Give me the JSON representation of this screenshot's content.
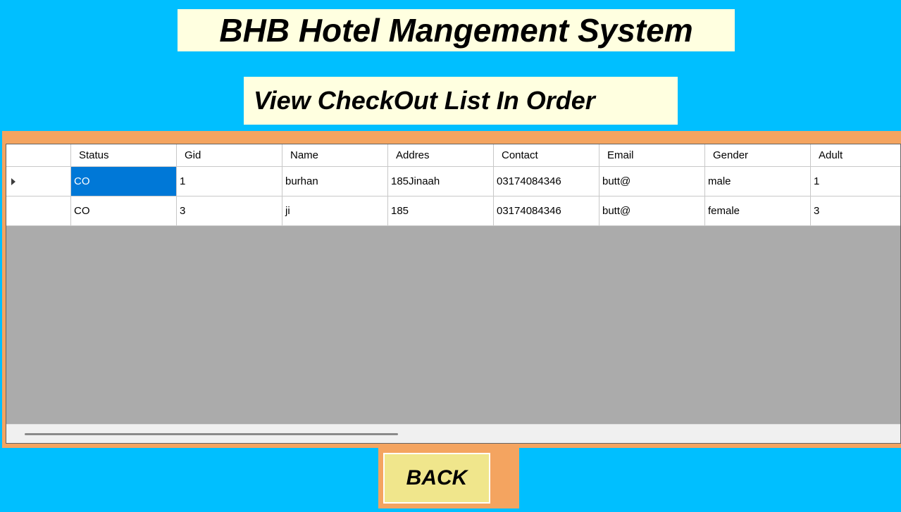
{
  "header": {
    "title": "BHB Hotel Mangement System",
    "subtitle": "View CheckOut List In Order"
  },
  "grid": {
    "columns": [
      "Status",
      "Gid",
      "Name",
      "Addres",
      "Contact",
      "Email",
      "Gender",
      "Adult"
    ],
    "rows": [
      [
        "CO",
        "1",
        "burhan",
        "185Jinaah",
        "03174084346",
        "butt@",
        "male",
        "1"
      ],
      [
        "CO",
        "3",
        "ji",
        "185",
        "03174084346",
        "butt@",
        "female",
        "3"
      ]
    ],
    "selected_row": 0,
    "selected_column": 0
  },
  "actions": {
    "back_label": "BACK"
  },
  "colors": {
    "background": "#00bfff",
    "title_box": "#ffffe0",
    "frame": "#f4a460",
    "grid_empty": "#ababab",
    "selection": "#0078d7",
    "back_button": "#f0e68c"
  }
}
